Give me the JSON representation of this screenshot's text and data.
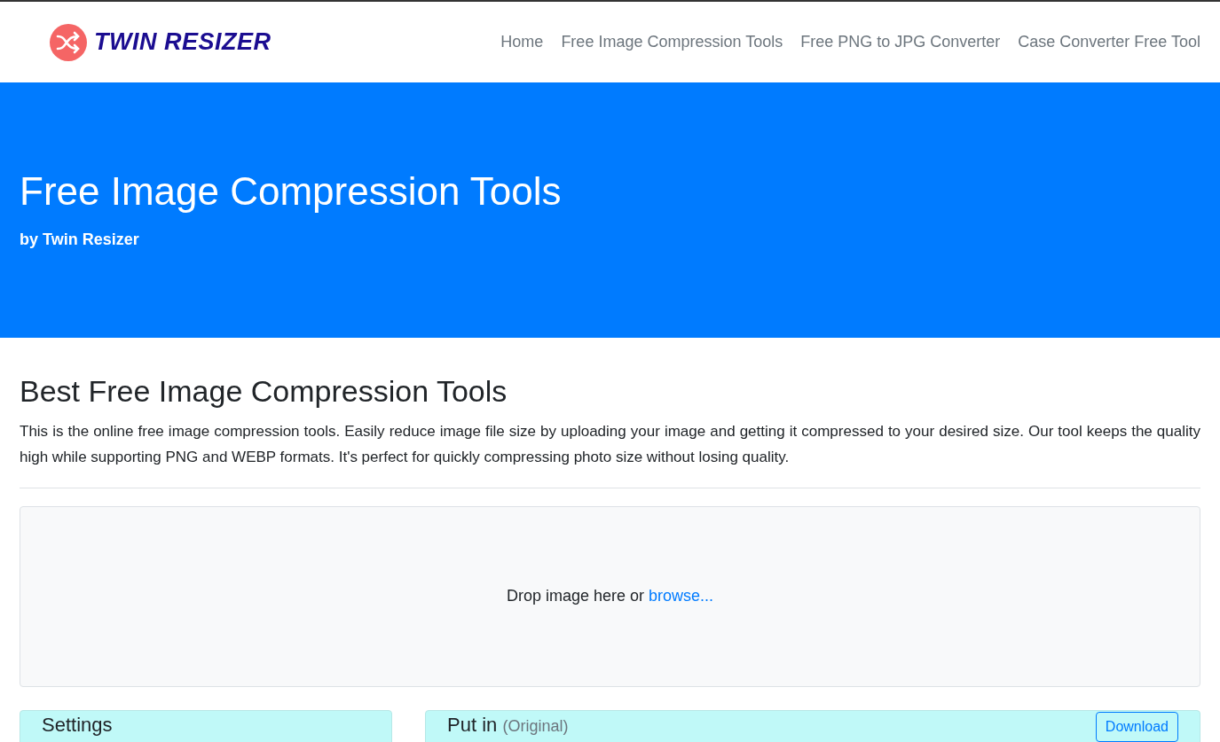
{
  "logo": {
    "text": "TWIN RESIZER"
  },
  "nav": [
    {
      "label": "Home"
    },
    {
      "label": "Free Image Compression Tools"
    },
    {
      "label": "Free PNG to JPG Converter"
    },
    {
      "label": "Case Converter Free Tool"
    }
  ],
  "hero": {
    "title": "Free Image Compression Tools",
    "subtitle": "by Twin Resizer"
  },
  "main": {
    "heading": "Best Free Image Compression Tools",
    "intro": "This is the online free image compression tools. Easily reduce image file size by uploading your image and getting it compressed to your desired size. Our tool keeps the quality high while supporting PNG and WEBP formats. It's perfect for quickly compressing photo size without losing quality."
  },
  "dropzone": {
    "text": "Drop image here or",
    "link": "browse..."
  },
  "settings_panel": {
    "title": "Settings"
  },
  "input_panel": {
    "title": "Put in",
    "note": "(Original)",
    "button": "Download"
  }
}
